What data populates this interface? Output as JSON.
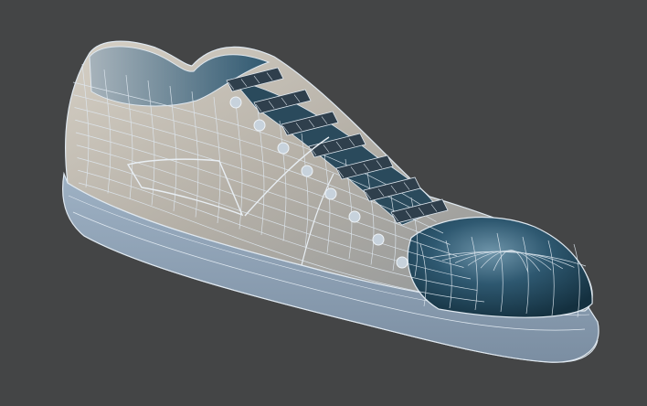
{
  "viewport": {
    "background": "#444546"
  },
  "model": {
    "object": "sneaker",
    "display_mode": "wireframe-on-shaded",
    "colors": {
      "sole": "#8fa3b7",
      "sole_shadow": "#6f8296",
      "upper": "#c9c4bb",
      "upper_shadow": "#8d8f90",
      "toe_dark": "#22455a",
      "toe_mid": "#3f6b82",
      "highlight": "#e3ecf2",
      "wire": "#dfe8f0",
      "lace": "#2f3f4c",
      "lace_light": "#7f93a4"
    }
  }
}
